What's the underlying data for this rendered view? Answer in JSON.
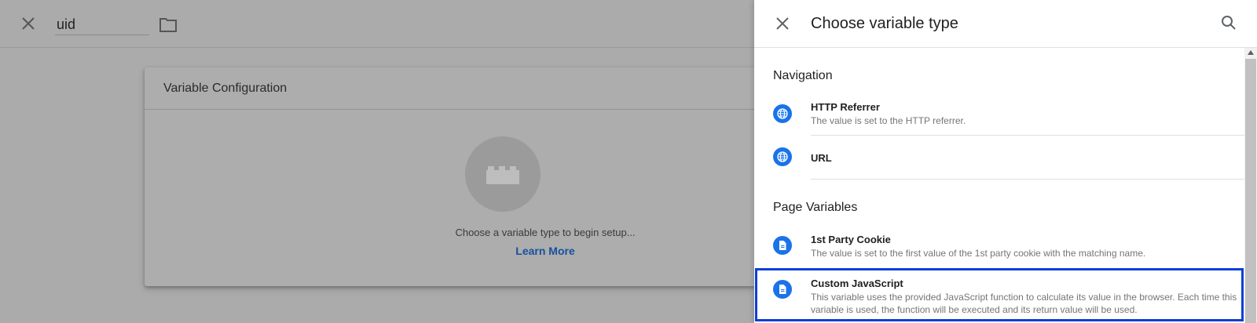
{
  "background": {
    "variable_name": "uid",
    "card_title": "Variable Configuration",
    "prompt_text": "Choose a variable type to begin setup...",
    "learn_more": "Learn More"
  },
  "panel": {
    "title": "Choose variable type",
    "sections": [
      {
        "title": "Navigation",
        "items": [
          {
            "title": "HTTP Referrer",
            "description": "The value is set to the HTTP referrer.",
            "icon": "globe-icon"
          },
          {
            "title": "URL",
            "description": "",
            "icon": "globe-icon"
          }
        ]
      },
      {
        "title": "Page Variables",
        "items": [
          {
            "title": "1st Party Cookie",
            "description": "The value is set to the first value of the 1st party cookie with the matching name.",
            "icon": "document-icon"
          },
          {
            "title": "Custom JavaScript",
            "description": "This variable uses the provided JavaScript function to calculate its value in the browser. Each time this variable is used, the function will be executed and its return value will be used.",
            "icon": "document-icon"
          }
        ]
      }
    ]
  },
  "colors": {
    "accent": "#1a73e8",
    "selection_border": "#0b3fd6",
    "link": "#16509d"
  }
}
